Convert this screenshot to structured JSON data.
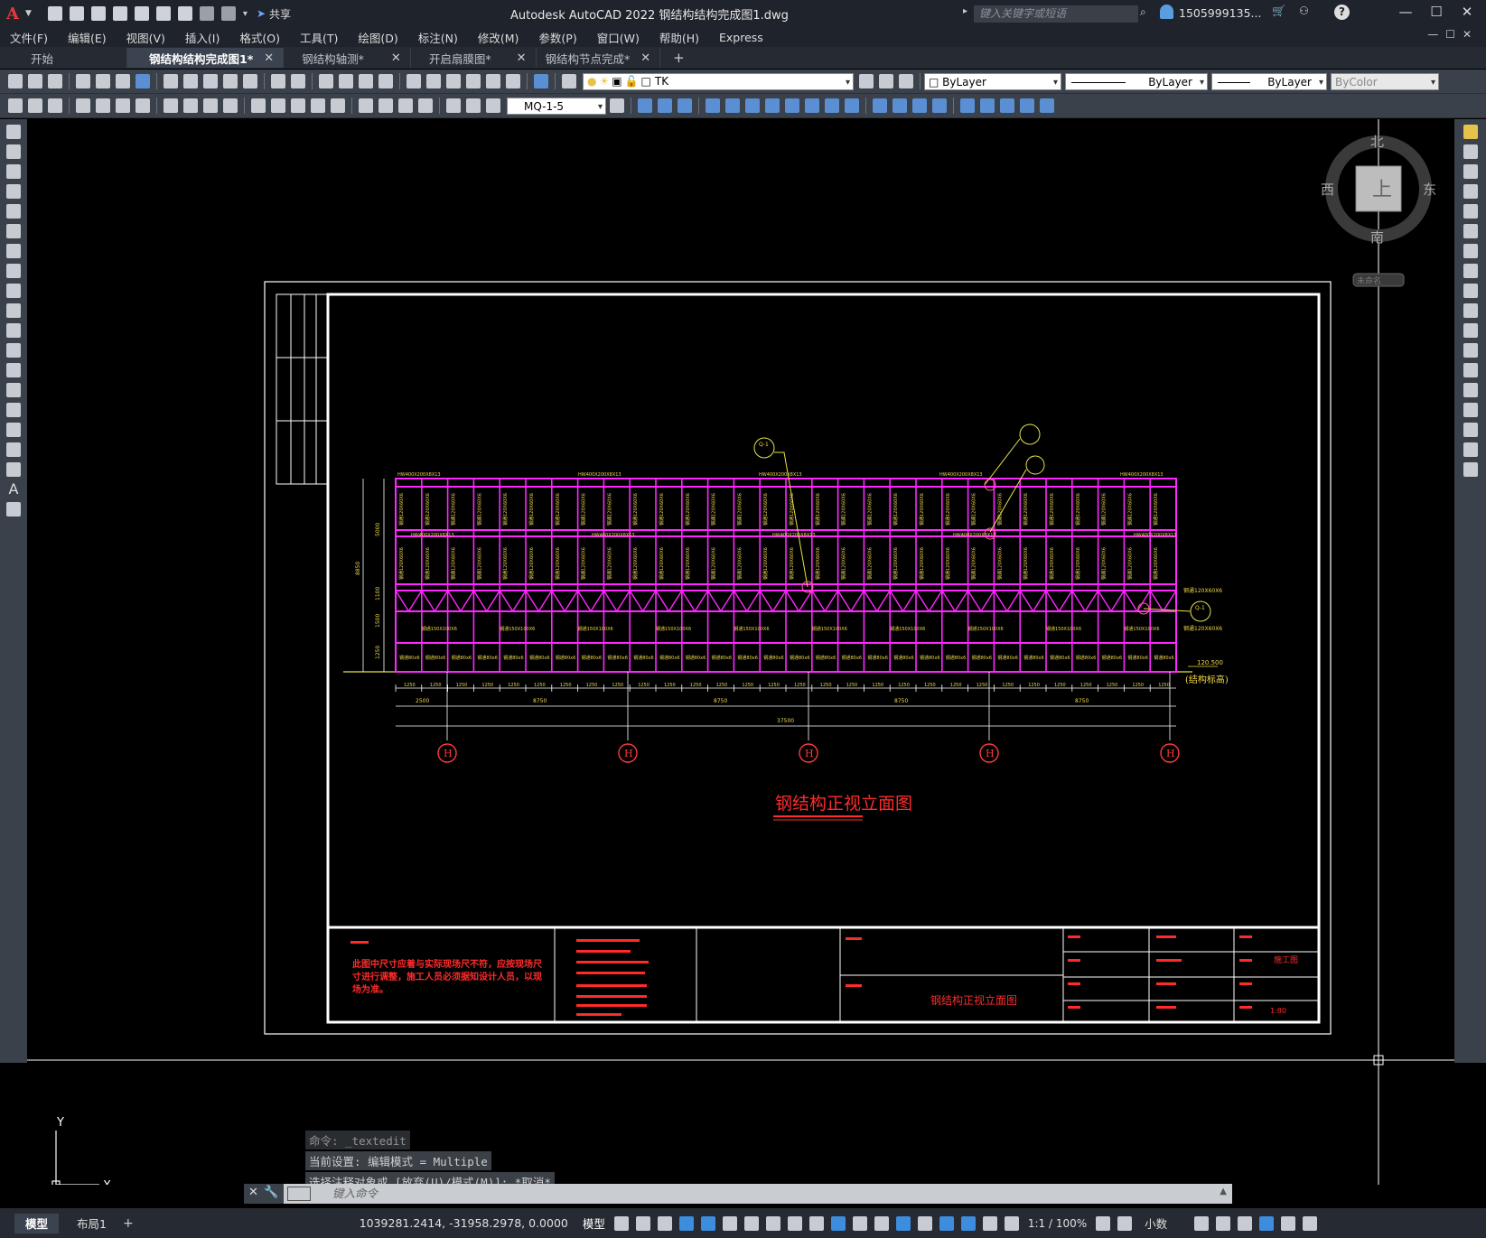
{
  "titlebar": {
    "app_logo": "A",
    "share_label": "共享",
    "title": "Autodesk AutoCAD 2022    钢结构结构完成图1.dwg",
    "search_placeholder": "键入关键字或短语",
    "user": "1505999135...",
    "help": "?"
  },
  "menu": [
    "文件(F)",
    "编辑(E)",
    "视图(V)",
    "插入(I)",
    "格式(O)",
    "工具(T)",
    "绘图(D)",
    "标注(N)",
    "修改(M)",
    "参数(P)",
    "窗口(W)",
    "帮助(H)",
    "Express"
  ],
  "tabs": [
    {
      "label": "开始",
      "closable": false,
      "active": false
    },
    {
      "label": "钢结构结构完成图1*",
      "closable": true,
      "active": true
    },
    {
      "label": "钢结构轴测*",
      "closable": true,
      "active": false
    },
    {
      "label": "开启扇膜图*",
      "closable": true,
      "active": false
    },
    {
      "label": "钢结构节点完成*",
      "closable": true,
      "active": false
    }
  ],
  "properties": {
    "layer": "TK",
    "color": "ByLayer",
    "linetype": "ByLayer",
    "lineweight": "ByLayer",
    "plotstyle": "ByColor",
    "dimstyle": "MQ-1-5"
  },
  "viewcube": {
    "north": "北",
    "south": "南",
    "east": "东",
    "west": "西",
    "top": "上",
    "wcs": "未命名"
  },
  "drawing": {
    "title": "钢结构正视立面图",
    "elevation_value": "120.500",
    "elevation_label": "(结构标高)",
    "axes": [
      "H",
      "H",
      "H",
      "H",
      "H"
    ],
    "dims_overall": "37500",
    "dims_bays": [
      "2500",
      "8750",
      "8750",
      "8750",
      "8750"
    ],
    "dims_sub": "1250",
    "member_top": "HW400X200X8X13",
    "member_col": "钢通120X60X6",
    "member_mid": "钢通150X100X6",
    "member_bot": "钢通80x6",
    "height_dims": [
      "5000",
      "1100",
      "1500",
      "1250"
    ],
    "total_height": "8850",
    "callout_top": "Q-1",
    "callout_right": "Q-1",
    "note_text": "此图中尺寸应着与实际现场尺不符，应按现场尺寸进行调整，施工人员必须据知设计人员，以现场为准。",
    "tb_title": "钢结构正视立面图",
    "tb_scale": "1:80",
    "tb_label_a": "施工图"
  },
  "ucs": {
    "x": "X",
    "y": "Y"
  },
  "command": {
    "history": [
      "命令: _textedit",
      "当前设置: 编辑模式 = Multiple",
      "选择注释对象或 [放弃(U)/模式(M)]: *取消*"
    ],
    "placeholder": "键入命令"
  },
  "status": {
    "layout_tabs": [
      "模型",
      "布局1"
    ],
    "coords": "1039281.2414, -31958.2978, 0.0000",
    "model": "模型",
    "scale": "1:1 / 100%",
    "units": "小数"
  }
}
